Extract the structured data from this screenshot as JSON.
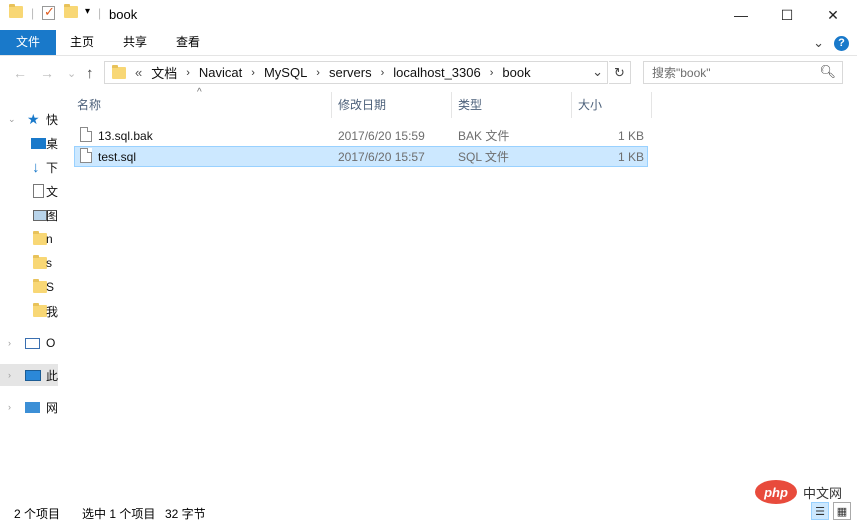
{
  "window": {
    "title": "book",
    "controls": {
      "minimize": "—",
      "maximize": "☐",
      "close": "✕"
    }
  },
  "ribbon": {
    "tabs": [
      "文件",
      "主页",
      "共享",
      "查看"
    ],
    "chevron": "⌄",
    "help": "?"
  },
  "navigation": {
    "back": "←",
    "forward": "→",
    "recent": "⌄",
    "up": "↑",
    "overflow": "«",
    "breadcrumb": [
      "文档",
      "Navicat",
      "MySQL",
      "servers",
      "localhost_3306",
      "book"
    ],
    "dropdown": "⌄",
    "refresh": "↻",
    "search_placeholder": "搜索\"book\"",
    "search_icon": "search-icon"
  },
  "navpane": {
    "items": [
      {
        "label": "快",
        "icon": "star-icon",
        "chevron": "⌄"
      },
      {
        "label": "桌",
        "icon": "desktop-icon"
      },
      {
        "label": "下",
        "icon": "download-icon"
      },
      {
        "label": "文",
        "icon": "document-icon"
      },
      {
        "label": "图",
        "icon": "picture-icon"
      },
      {
        "label": "n",
        "icon": "folder-icon"
      },
      {
        "label": "s",
        "icon": "folder-icon"
      },
      {
        "label": "S",
        "icon": "folder-icon"
      },
      {
        "label": "我",
        "icon": "folder-icon"
      },
      {
        "label": "O",
        "icon": "onedrive-icon",
        "chevron": "›"
      },
      {
        "label": "此",
        "icon": "this-pc-icon",
        "chevron": "›",
        "selected": true
      },
      {
        "label": "网",
        "icon": "network-icon",
        "chevron": "›"
      }
    ]
  },
  "columns": [
    "名称",
    "修改日期",
    "类型",
    "大小"
  ],
  "sort_indicator": "^",
  "files": [
    {
      "name": "13.sql.bak",
      "modified": "2017/6/20 15:59",
      "type": "BAK 文件",
      "size": "1 KB",
      "selected": false
    },
    {
      "name": "test.sql",
      "modified": "2017/6/20 15:57",
      "type": "SQL 文件",
      "size": "1 KB",
      "selected": true
    }
  ],
  "status": {
    "item_count": "2 个项目",
    "selection": "选中 1 个项目",
    "size": "32 字节"
  },
  "watermark": {
    "logo": "php",
    "text": "中文网"
  },
  "colors": {
    "accent": "#1979ca",
    "selection_bg": "#cce8ff",
    "selection_border": "#99d1ff",
    "header_text": "#4c607a"
  }
}
